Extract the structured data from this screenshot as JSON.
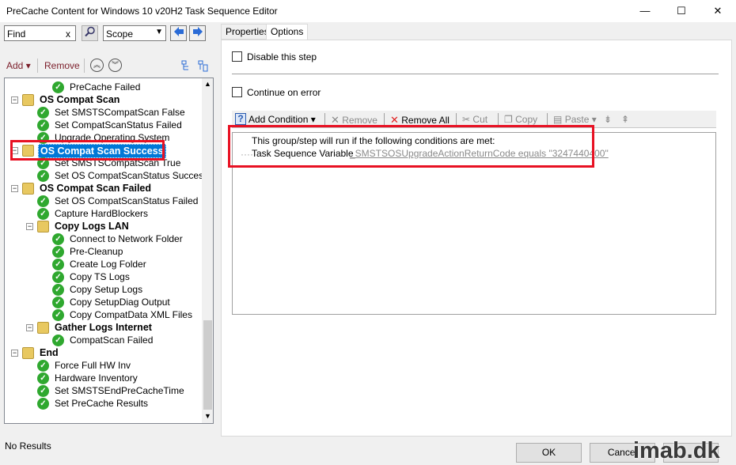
{
  "window": {
    "title": "PreCache Content for Windows 10 v20H2 Task Sequence Editor",
    "minimize_symbol": "—",
    "maximize_symbol": "☐",
    "close_symbol": "✕"
  },
  "search": {
    "value": "Find",
    "clear_symbol": "x",
    "scope_value": "Scope",
    "dropdown_symbol": "▼",
    "find_icon": "magnifier-icon",
    "back_symbol": "🡄",
    "forward_symbol": "🡆"
  },
  "tree_toolbar": {
    "add_label": "Add",
    "add_arrow": "▾",
    "remove_label": "Remove",
    "up_symbol": "︽",
    "down_symbol": "︾"
  },
  "tree": {
    "items": [
      {
        "label": "PreCache Failed",
        "type": "step"
      },
      {
        "label": "OS Compat Scan",
        "type": "group"
      },
      {
        "label": "Set SMSTSCompatScan False",
        "type": "step"
      },
      {
        "label": "Set CompatScanStatus Failed",
        "type": "step"
      },
      {
        "label": "Upgrade Operating System",
        "type": "step"
      },
      {
        "label": "OS Compat Scan Success",
        "type": "group",
        "selected": true
      },
      {
        "label": "Set SMSTSCompatScan True",
        "type": "step"
      },
      {
        "label": "Set OS CompatScanStatus Success",
        "type": "step"
      },
      {
        "label": "OS Compat Scan Failed",
        "type": "group"
      },
      {
        "label": "Set OS CompatScanStatus Failed",
        "type": "step"
      },
      {
        "label": "Capture HardBlockers",
        "type": "step"
      },
      {
        "label": "Copy Logs LAN",
        "type": "group"
      },
      {
        "label": "Connect to Network Folder",
        "type": "step"
      },
      {
        "label": "Pre-Cleanup",
        "type": "step"
      },
      {
        "label": "Create Log Folder",
        "type": "step"
      },
      {
        "label": "Copy TS Logs",
        "type": "step"
      },
      {
        "label": "Copy Setup Logs",
        "type": "step"
      },
      {
        "label": "Copy SetupDiag Output",
        "type": "step"
      },
      {
        "label": "Copy CompatData XML Files",
        "type": "step"
      },
      {
        "label": "Gather Logs Internet",
        "type": "group"
      },
      {
        "label": "CompatScan Failed",
        "type": "step"
      },
      {
        "label": "End",
        "type": "group"
      },
      {
        "label": "Force Full HW Inv",
        "type": "step"
      },
      {
        "label": "Hardware Inventory",
        "type": "step"
      },
      {
        "label": "Set SMSTSEndPreCacheTime",
        "type": "step"
      },
      {
        "label": "Set PreCache Results",
        "type": "step"
      }
    ],
    "check_symbol": "✓",
    "expander_symbol": "−"
  },
  "status_bar": {
    "text": "No Results"
  },
  "tabs": [
    {
      "label": "Properties",
      "active": false
    },
    {
      "label": "Options",
      "active": true
    }
  ],
  "options": {
    "disable_step_label": "Disable this step",
    "continue_on_error_label": "Continue on error",
    "condition_toolbar": {
      "add_condition": "Add Condition",
      "remove": "Remove",
      "remove_all": "Remove All",
      "cut": "Cut",
      "copy": "Copy",
      "paste": "Paste"
    },
    "conditions_header": "This group/step will run if the following conditions are met:",
    "condition_type": "Task Sequence Variable",
    "condition_value": "_SMSTSOSUpgradeActionReturnCode equals \"3247440400\""
  },
  "buttons": {
    "ok": "OK",
    "cancel": "Cancel"
  },
  "watermark": "imab.dk",
  "colors": {
    "selection": "#0078d7",
    "highlight_box": "#e81123",
    "step_check": "#2fa82f",
    "folder": "#e8c860",
    "link_value": "#8a8a8a"
  }
}
